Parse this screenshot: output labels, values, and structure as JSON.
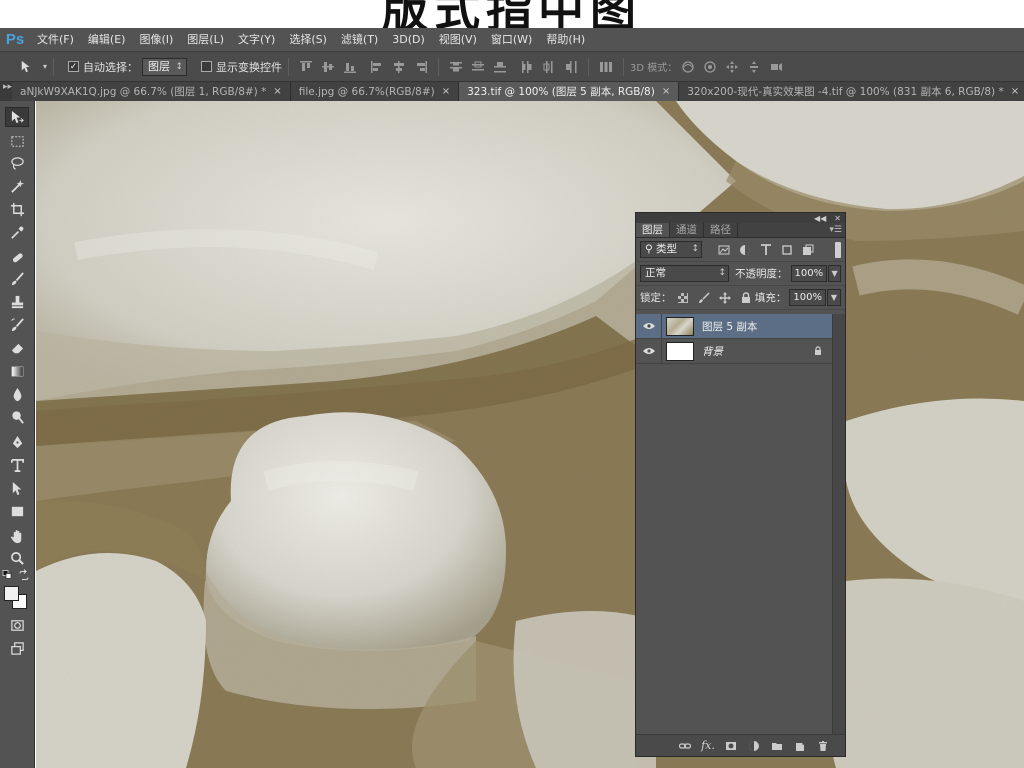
{
  "banner": {
    "title": "版式指中图"
  },
  "app": {
    "logo": "Ps"
  },
  "menubar": {
    "items": [
      "文件(F)",
      "编辑(E)",
      "图像(I)",
      "图层(L)",
      "文字(Y)",
      "选择(S)",
      "滤镜(T)",
      "3D(D)",
      "视图(V)",
      "窗口(W)",
      "帮助(H)"
    ]
  },
  "optionsbar": {
    "auto_select_label": "自动选择：",
    "auto_select_checked": true,
    "auto_select_value": "图层",
    "show_transform_label": "显示变换控件",
    "show_transform_checked": false,
    "mode_3d_label": "3D 模式："
  },
  "tabs": [
    {
      "label": "aNJkW9XAK1Q.jpg @ 66.7% (图层 1, RGB/8#) *",
      "active": false
    },
    {
      "label": "file.jpg @ 66.7%(RGB/8#)",
      "active": false
    },
    {
      "label": "323.tif @ 100% (图层 5 副本, RGB/8)",
      "active": true
    },
    {
      "label": "320x200-现代-真实效果图 -4.tif @ 100% (831 副本 6, RGB/8) *",
      "active": false
    }
  ],
  "tab_close_glyph": "×",
  "layers_panel": {
    "tabs": [
      "图层",
      "通道",
      "路径"
    ],
    "filter_label": "类型",
    "blend_mode": "正常",
    "opacity_label": "不透明度：",
    "opacity_value": "100%",
    "lock_label": "锁定：",
    "fill_label": "填充：",
    "fill_value": "100%",
    "layers": [
      {
        "name": "图层 5 副本",
        "selected": true,
        "visible": true,
        "locked": false,
        "italic": false
      },
      {
        "name": "背景",
        "selected": false,
        "visible": true,
        "locked": true,
        "italic": true
      }
    ],
    "bottom_fx": "fx."
  },
  "colors": {
    "foreground": "#f2f2f2",
    "background": "#ffffff",
    "ui_dark": "#535353",
    "selection": "#5c6e86",
    "logo_blue": "#4aa3df"
  },
  "icons": {
    "tools": [
      "move-icon",
      "marquee-icon",
      "lasso-icon",
      "magic-wand-icon",
      "crop-icon",
      "eyedropper-icon",
      "healing-brush-icon",
      "brush-icon",
      "clone-stamp-icon",
      "history-brush-icon",
      "eraser-icon",
      "gradient-icon",
      "blur-icon",
      "dodge-icon",
      "pen-icon",
      "type-icon",
      "path-select-icon",
      "rectangle-icon",
      "hand-icon",
      "zoom-icon",
      "quick-mask-icon",
      "screen-mode-icon"
    ]
  }
}
